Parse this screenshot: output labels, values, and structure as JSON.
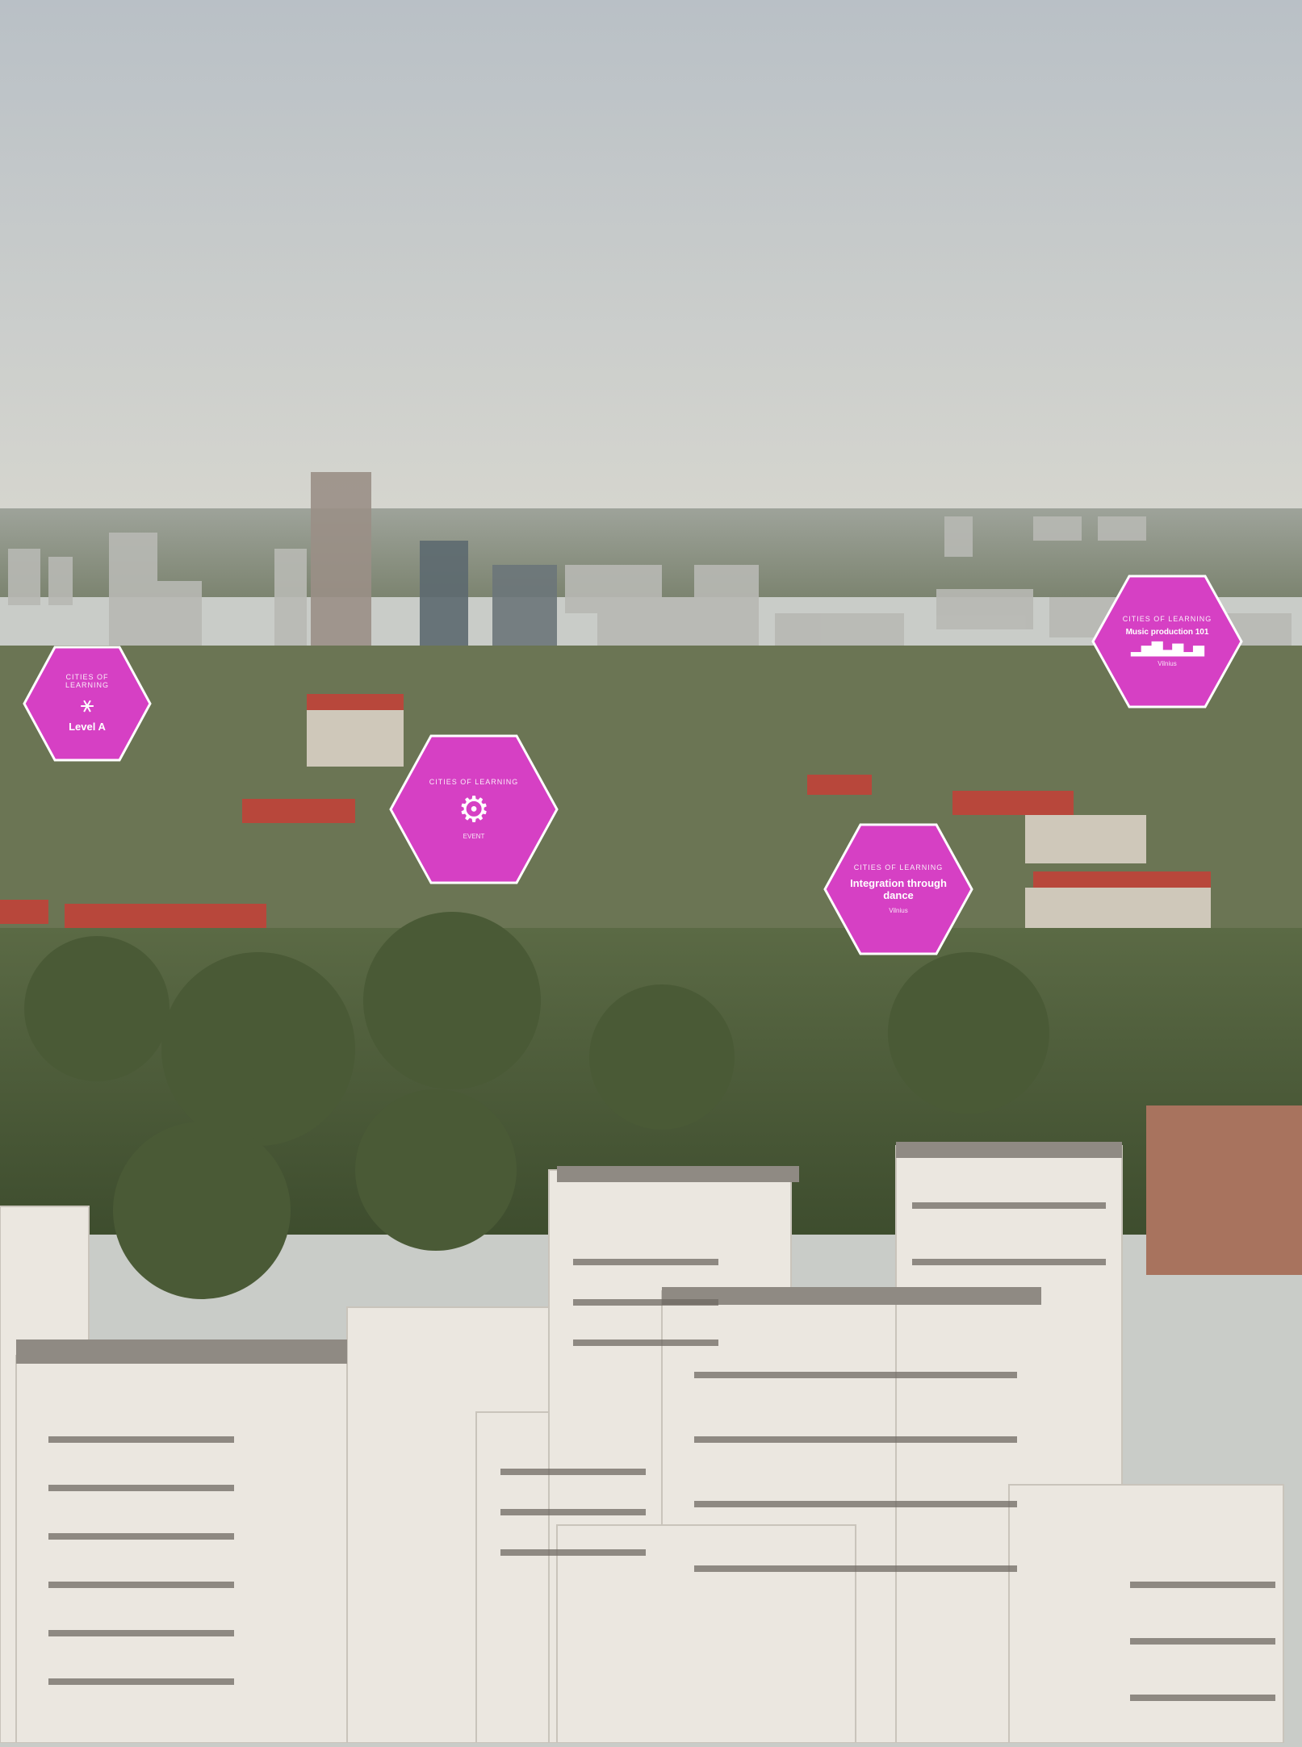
{
  "scene": {
    "description_icon": "aerial-city-skyline"
  },
  "colors": {
    "hex_fill": "#d640c4",
    "hex_stroke": "#ffffff"
  },
  "hexagons": [
    {
      "id": "level",
      "brand": "CITIES OF LEARNING",
      "title": "Level A",
      "sub": "",
      "icon": "dancer-icon"
    },
    {
      "id": "event",
      "brand": "CITIES OF LEARNING",
      "title": "",
      "sub": "EVENT",
      "icon": "globe-gear-icon"
    },
    {
      "id": "dance",
      "brand": "CITIES OF LEARNING",
      "title": "Integration through dance",
      "sub": "Vilnius",
      "icon": ""
    },
    {
      "id": "music",
      "brand": "CITIES OF LEARNING",
      "title": "Music production 101",
      "sub": "Vilnius",
      "icon": "soundwave-icon"
    }
  ]
}
